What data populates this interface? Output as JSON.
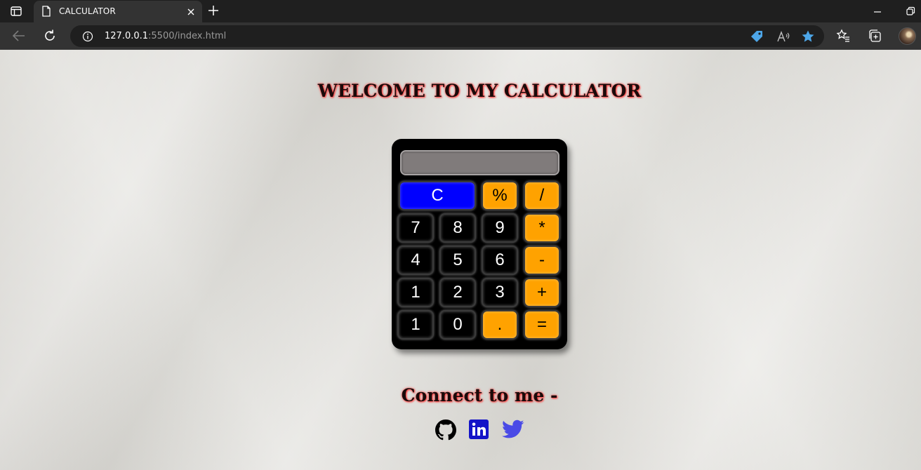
{
  "browser": {
    "tab_title": "CALCULATOR",
    "url_host": "127.0.0.1",
    "url_rest": ":5500/index.html"
  },
  "page": {
    "heading": "WELCOME TO MY CALCULATOR",
    "connect_text": "Connect to me -",
    "social_links": [
      "github-icon",
      "linkedin-icon",
      "twitter-icon"
    ]
  },
  "calculator": {
    "display_value": "",
    "keys": {
      "clear": "C",
      "percent": "%",
      "divide": "/",
      "seven": "7",
      "eight": "8",
      "nine": "9",
      "multiply": "*",
      "four": "4",
      "five": "5",
      "six": "6",
      "minus": "-",
      "one": "1",
      "two": "2",
      "three": "3",
      "plus": "+",
      "one_b": "1",
      "zero": "0",
      "decimal": ".",
      "equals": "="
    }
  },
  "colors": {
    "clear_key": "#0000ff",
    "operator_key": "#ffa200",
    "number_key": "#000000",
    "heading_glow": "#ff3b3b",
    "social_icon": "#1414c8"
  }
}
